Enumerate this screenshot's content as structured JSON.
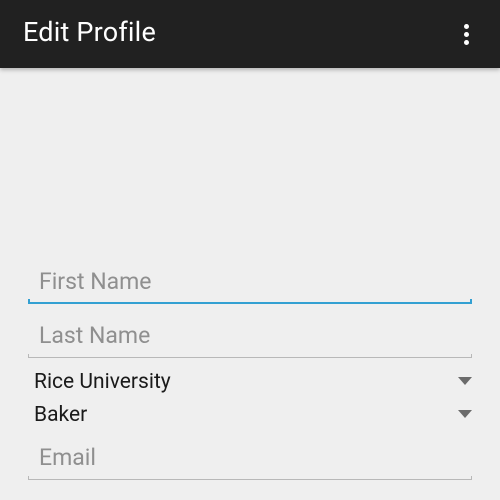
{
  "app_bar": {
    "title": "Edit Profile",
    "overflow_icon": "more-vert-icon"
  },
  "form": {
    "first_name": {
      "placeholder": "First Name",
      "value": ""
    },
    "last_name": {
      "placeholder": "Last Name",
      "value": ""
    },
    "university": {
      "selected": "Rice University"
    },
    "college": {
      "selected": "Baker"
    },
    "email": {
      "placeholder": "Email",
      "value": ""
    }
  },
  "colors": {
    "app_bar": "#212121",
    "background": "#efefef",
    "focus_accent": "#33a0d2",
    "underline": "#b8b8b8"
  }
}
